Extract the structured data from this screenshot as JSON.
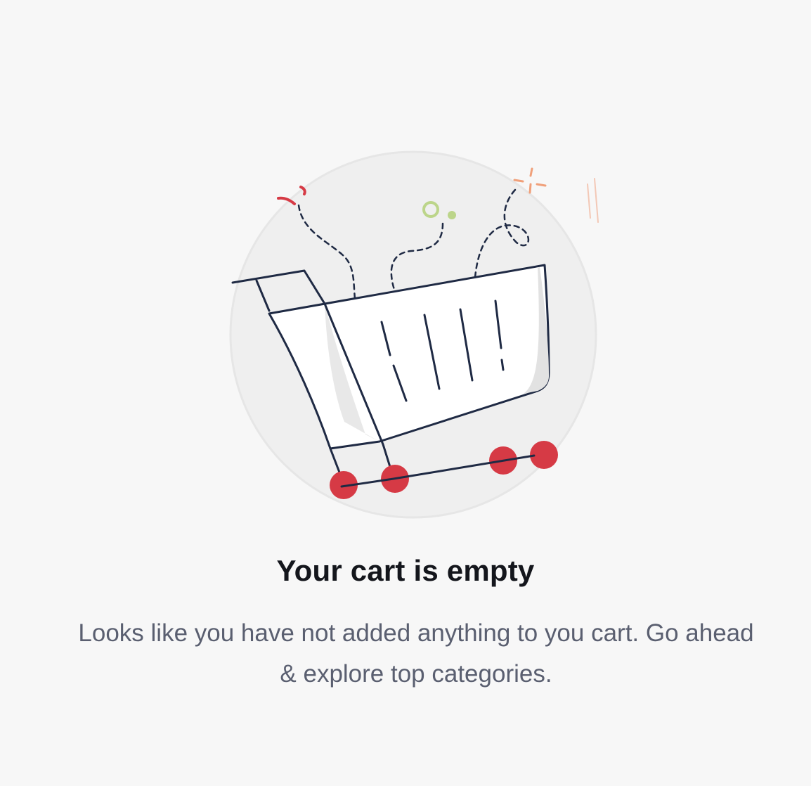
{
  "empty_state": {
    "illustration": "empty-shopping-cart-illustration",
    "title": "Your cart is empty",
    "message": "Looks like you have not added anything to you cart. Go ahead & explore top categories."
  },
  "colors": {
    "background": "#f7f7f7",
    "circle": "#efefef",
    "cart_outline": "#1f2a44",
    "wheels": "#d63a45",
    "accent_green": "#bcd58a",
    "accent_orange": "#f0a07a",
    "title_text": "#14161c",
    "message_text": "#5a5f70"
  }
}
